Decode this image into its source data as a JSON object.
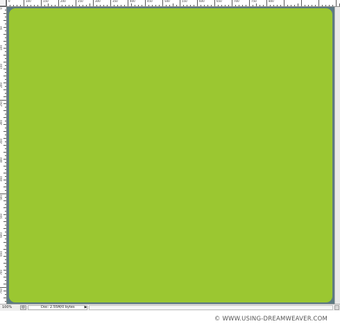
{
  "ruler": {
    "top_labels": [
      "0",
      "100",
      "150",
      "200",
      "250",
      "300",
      "350",
      "400",
      "450",
      "500",
      "550",
      "600",
      "650",
      "700",
      "750",
      "800"
    ],
    "left_labels": [
      "0",
      "50",
      "100",
      "150",
      "200",
      "250",
      "300",
      "350",
      "400",
      "450",
      "500",
      "550",
      "600",
      "650",
      "700",
      "750"
    ]
  },
  "status_bar": {
    "zoom": "100%",
    "doc_info": "Doc: 2.55M/0 bytes",
    "nav_icon": "navigator-icon",
    "arrow_icon": "triangle-right-icon"
  },
  "document": {
    "fill_color": "#9bc731",
    "border_color": "#5d7a82"
  },
  "watermark": "© WWW.USING-DREAMWEAVER.COM"
}
